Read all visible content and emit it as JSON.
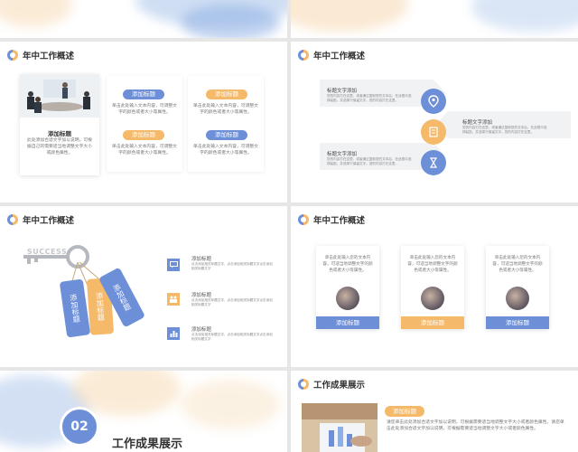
{
  "colors": {
    "blue": "#6d8fd8",
    "orange": "#f5b96a",
    "text": "#333333"
  },
  "section_title": "年中工作概述",
  "slide3": {
    "left_card": {
      "title": "添加标题",
      "body": "此处添加合适文字加以说明，可根据自己的需要适当地调整文字大小或颜色属性。"
    },
    "blocks": [
      {
        "title": "添加标题",
        "body": "单击此处输入文本内容，可调整文字的颜色或者大小等属性。"
      },
      {
        "title": "添加标题",
        "body": "单击此处输入文本内容，可调整文字的颜色或者大小等属性。"
      },
      {
        "title": "添加标题",
        "body": "单击此处输入文本内容，可调整文字的颜色或者大小等属性。"
      },
      {
        "title": "添加标题",
        "body": "单击此处输入文本内容，可调整文字的颜色或者大小等属性。"
      }
    ]
  },
  "slide4": {
    "items": [
      {
        "title": "标题文字添加",
        "body": "您的内容打在这里，或者通过复制您的文本后，在此框中选择粘贴，并选择只保留文字。您的内容打在这里。",
        "icon": "location-pin-icon"
      },
      {
        "title": "标题文字添加",
        "body": "您的内容打在这里，或者通过复制您的文本后，在此框中选择粘贴，并选择只保留文字。您的内容打在这里。",
        "icon": "document-icon"
      },
      {
        "title": "标题文字添加",
        "body": "您的内容打在这里，或者通过复制您的文本后，在此框中选择粘贴，并选择只保留文字。您的内容打在这里。",
        "icon": "hourglass-icon"
      }
    ]
  },
  "slide5": {
    "key_text": "SUCCESS",
    "tags": [
      "添加标题",
      "添加标题",
      "添加标题"
    ],
    "items": [
      {
        "title": "添加标题",
        "body": "点击添加相关标题文字，点击添加相关标题文字点击添加相关标题文字",
        "icon": "chat-icon"
      },
      {
        "title": "添加标题",
        "body": "点击添加相关标题文字，点击添加相关标题文字点击添加相关标题文字",
        "icon": "people-icon"
      },
      {
        "title": "添加标题",
        "body": "点击添加相关标题文字，点击添加相关标题文字点击添加相关标题文字",
        "icon": "bar-chart-icon"
      }
    ]
  },
  "slide6": {
    "cards": [
      {
        "body": "单击此处输入您的文本内容，可适当地调整文字的颜色或者大小等属性。",
        "label": "添加标题"
      },
      {
        "body": "单击此处输入您的文本内容，可适当地调整文字的颜色或者大小等属性。",
        "label": "添加标题"
      },
      {
        "body": "单击此处输入您的文本内容，可适当地调整文字的颜色或者大小等属性。",
        "label": "添加标题"
      }
    ]
  },
  "slide7": {
    "number": "02",
    "title": "工作成果展示"
  },
  "slide8": {
    "title": "工作成果展示",
    "tag": "添加标题",
    "body": "请您单击此处添加合适文字加以说明，可根据需要适当地调整文字大小或者颜色属性。请您单击此处添加合适文字加以说明，可根据需要适当地调整文字大小或者颜色属性。"
  }
}
